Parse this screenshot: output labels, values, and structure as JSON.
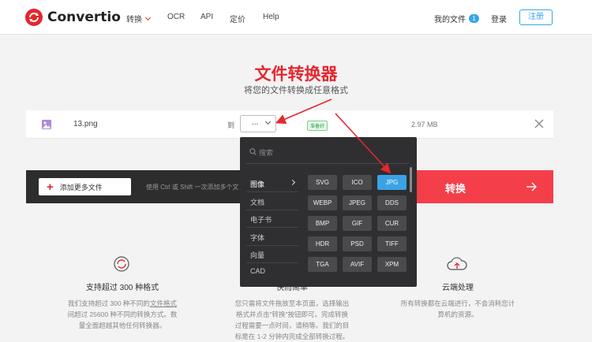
{
  "header": {
    "logo_text": "Convertio",
    "nav": {
      "convert": "转换",
      "ocr": "OCR",
      "api": "API",
      "pricing": "定价",
      "help": "Help"
    },
    "my_files": "我的文件",
    "my_files_count": "1",
    "login": "登录",
    "signup": "注册"
  },
  "hero": {
    "title": "文件转换器",
    "subtitle": "将您的文件转换成任意格式"
  },
  "file": {
    "name": "13.png",
    "to_label": "到",
    "format_value": "...",
    "status": "准备好",
    "size": "2.97 MB"
  },
  "actions": {
    "add_files": "添加更多文件",
    "hint": "使用 Ctrl 或 Shift 一次添加多个文",
    "convert": "转换"
  },
  "dropdown": {
    "search_placeholder": "搜索",
    "categories": [
      "图像",
      "文档",
      "电子书",
      "字体",
      "向量",
      "CAD"
    ],
    "formats": [
      "SVG",
      "ICO",
      "JPG",
      "WEBP",
      "JPEG",
      "DDS",
      "BMP",
      "GIF",
      "CUR",
      "HDR",
      "PSD",
      "TIFF",
      "TGA",
      "AVIF",
      "XPM"
    ],
    "selected_format": "JPG"
  },
  "features": [
    {
      "title": "支持超过 300 种格式",
      "text_lines": [
        "我们支持超过 300 种不同的",
        "文件格式",
        "间超过 25600 种不同的转换方式。数",
        "量全面超越其他任何转换器。"
      ]
    },
    {
      "title": "快而简单",
      "text_lines": [
        "您只需将文件拖放至本页面，选择输出",
        "格式并点击\"转换\"按钮即可。完成转换",
        "过程需要一点时间，请稍等。我们的目",
        "标是在 1-2 分钟内完成全部转换过程。"
      ]
    },
    {
      "title": "云端处理",
      "text_lines": [
        "所有转换都在云端进行，不会消耗您计",
        "算机的资源。"
      ]
    }
  ],
  "colors": {
    "brand_red": "#e5262e",
    "convert_red": "#f43f4a",
    "accent_blue": "#3aa3e6",
    "dark_bar": "#2d2d2d"
  }
}
